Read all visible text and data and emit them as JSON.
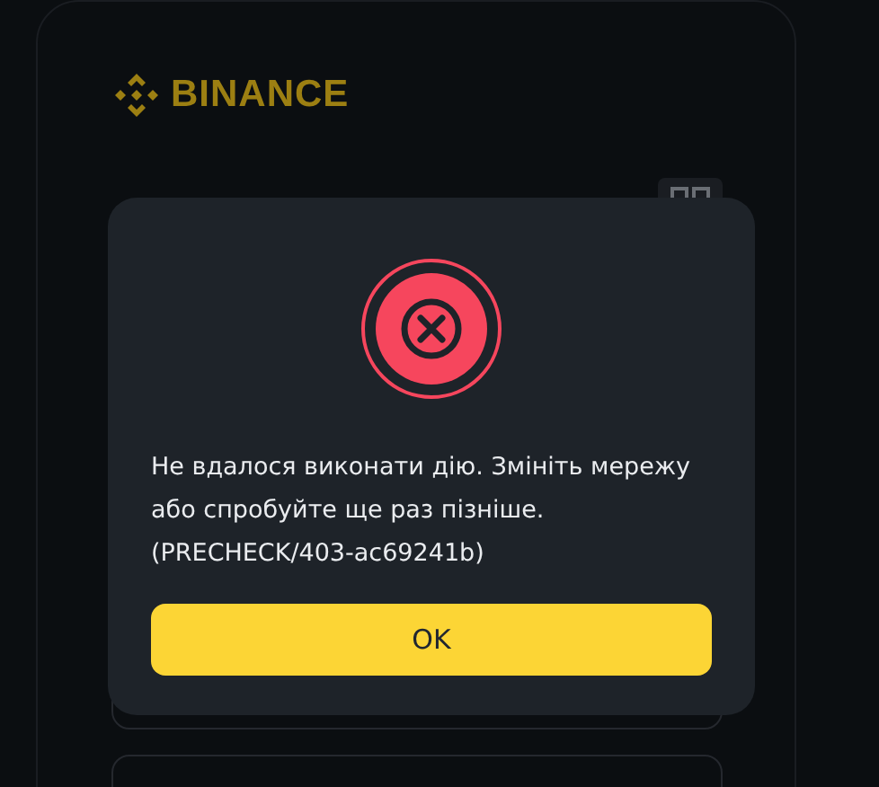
{
  "logo": {
    "text": "BINANCE"
  },
  "dialog": {
    "kind": "error",
    "message": "Не вдалося виконати дію. Змініть мережу або спробуйте ще раз пізніше.(PRECHECK/403-ac69241b)",
    "button": "OK"
  }
}
